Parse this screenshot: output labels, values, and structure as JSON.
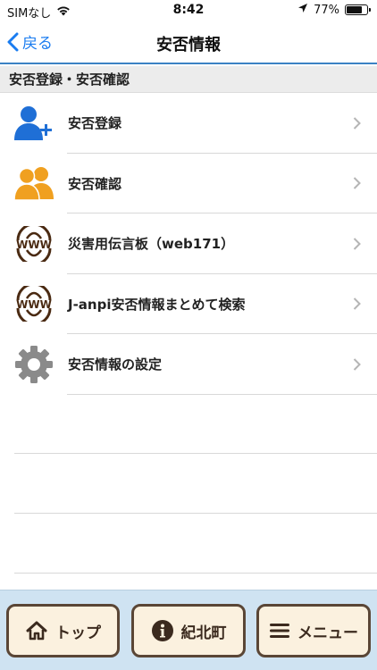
{
  "status_bar": {
    "carrier": "SIMなし",
    "time": "8:42",
    "battery_percent": "77%",
    "battery_level": 0.77
  },
  "nav": {
    "back_label": "戻る",
    "title": "安否情報"
  },
  "section": {
    "header": "安否登録・安否確認"
  },
  "items": [
    {
      "label": "安否登録",
      "icon": "person-add-icon",
      "color": "#1f6fd6"
    },
    {
      "label": "安否確認",
      "icon": "people-icon",
      "color": "#f0a020"
    },
    {
      "label": "災害用伝言板（web171）",
      "icon": "www-icon",
      "color": "#4a2a12"
    },
    {
      "label": "J-anpi安否情報まとめて検索",
      "icon": "www-icon",
      "color": "#4a2a12"
    },
    {
      "label": "安否情報の設定",
      "icon": "gear-icon",
      "color": "#8a8a8a"
    }
  ],
  "toolbar": {
    "top_label": "トップ",
    "info_label": "紀北町",
    "menu_label": "メニュー"
  },
  "colors": {
    "accent": "#1a7cf0",
    "toolbar_bg": "#cfe3f2",
    "button_bg": "#fbf1df",
    "button_border": "#5a4636"
  }
}
